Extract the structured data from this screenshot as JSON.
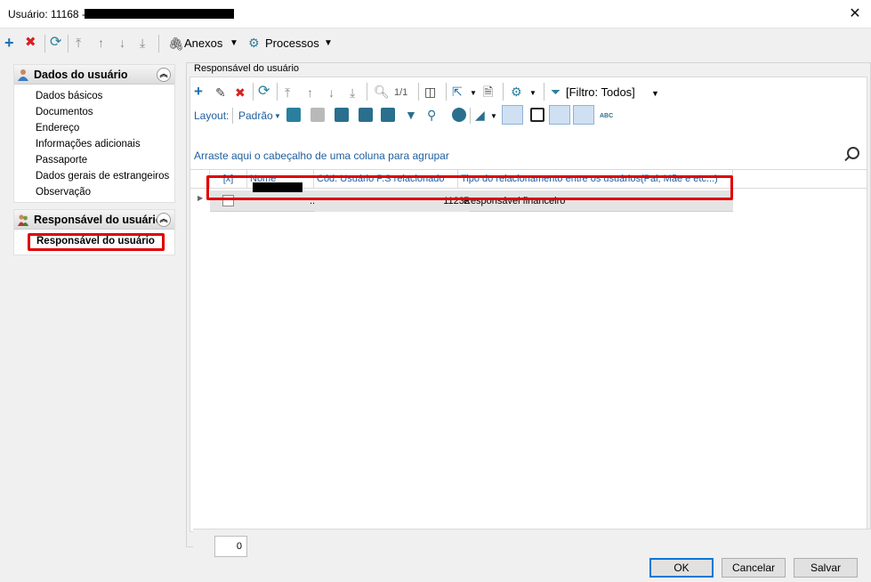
{
  "window": {
    "title": "Usuário: 11168 -",
    "close_glyph": "✕"
  },
  "toolbar": {
    "anexos_label": "Anexos",
    "processos_label": "Processos"
  },
  "sidebar": {
    "group1_title": "Dados do usuário",
    "group1_items": [
      "Dados básicos",
      "Documentos",
      "Endereço",
      "Informações adicionais",
      "Passaporte",
      "Dados gerais de estrangeiros",
      "Observação"
    ],
    "group2_title": "Responsável do usuário",
    "group2_items": [
      "Responsável do usuário"
    ]
  },
  "panel": {
    "title": "Responsável do usuário",
    "pager": "1/1",
    "filter_label": "[Filtro: Todos]",
    "layout_label": "Layout:",
    "layout_value": "Padrão",
    "group_hint": "Arraste aqui o cabeçalho de uma coluna para agrupar",
    "columns": [
      "[x]",
      "Nome",
      "Cód. Usuário P.S relacionado",
      "Tipo do relacionamento entre os usuários(Pai, Mãe e etc...)"
    ],
    "row": {
      "name_suffix": "...",
      "code": "11232",
      "relation": "Responsável financeiro"
    },
    "count": "0"
  },
  "buttons": {
    "ok": "OK",
    "cancel": "Cancelar",
    "save": "Salvar"
  },
  "colors": {
    "highlight": "#e00000",
    "icon_blue": "#1f6fb2",
    "icon_red": "#d62121"
  }
}
